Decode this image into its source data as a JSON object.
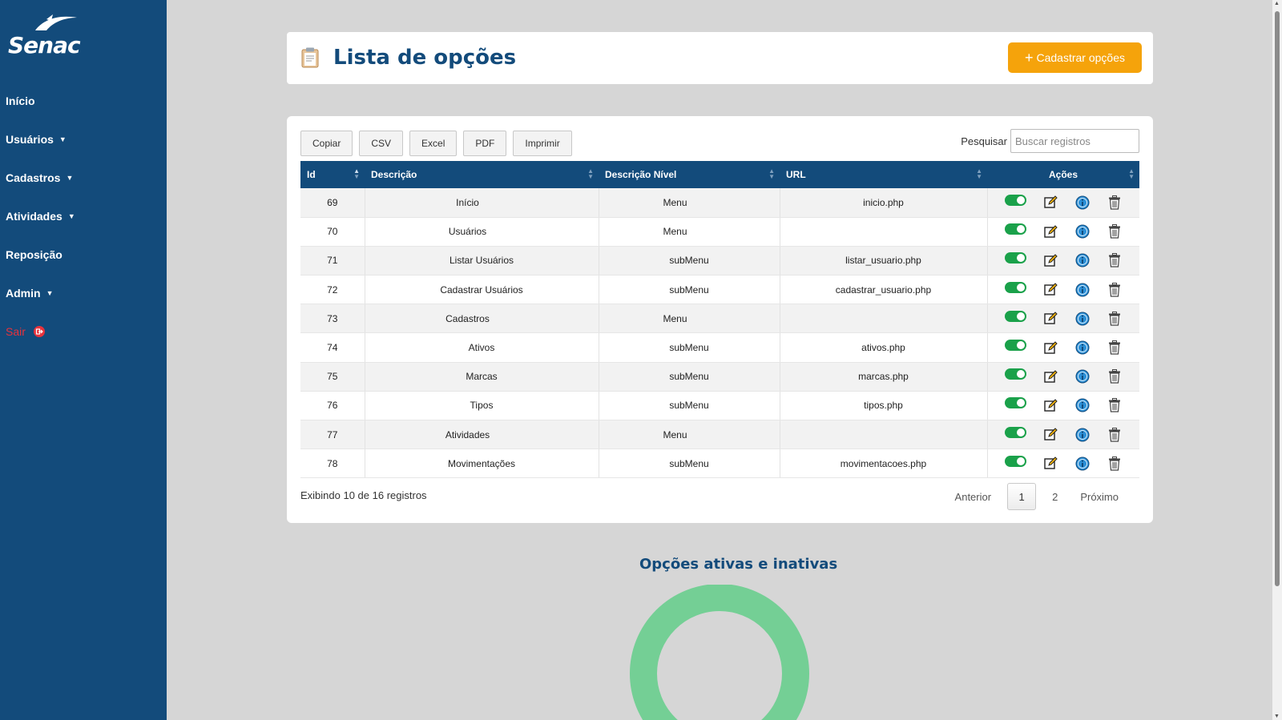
{
  "brand": {
    "logo_text": "Senac",
    "sidebar_color": "#134b7b"
  },
  "sidebar": {
    "items": [
      {
        "label": "Início",
        "has_caret": false
      },
      {
        "label": "Usuários",
        "has_caret": true
      },
      {
        "label": "Cadastros",
        "has_caret": true
      },
      {
        "label": "Atividades",
        "has_caret": true
      },
      {
        "label": "Reposição",
        "has_caret": false
      },
      {
        "label": "Admin",
        "has_caret": true
      }
    ],
    "logout_label": "Sair"
  },
  "header": {
    "title": "Lista de opções",
    "add_button_label": "Cadastrar opções",
    "add_button_color": "#f5a30b"
  },
  "toolbar": {
    "copy": "Copiar",
    "csv": "CSV",
    "excel": "Excel",
    "pdf": "PDF",
    "print": "Imprimir"
  },
  "search": {
    "label": "Pesquisar",
    "placeholder": "Buscar registros",
    "value": ""
  },
  "table": {
    "columns": [
      "Id",
      "Descrição",
      "Descrição Nível",
      "URL",
      "Ações"
    ],
    "rows": [
      {
        "id": "69",
        "descricao": "Início",
        "nivel": "Menu",
        "url": "inicio.php",
        "active": true
      },
      {
        "id": "70",
        "descricao": "Usuários",
        "nivel": "Menu",
        "url": "",
        "active": true
      },
      {
        "id": "71",
        "descricao": "Listar Usuários",
        "nivel": "subMenu",
        "url": "listar_usuario.php",
        "active": true
      },
      {
        "id": "72",
        "descricao": "Cadastrar Usuários",
        "nivel": "subMenu",
        "url": "cadastrar_usuario.php",
        "active": true
      },
      {
        "id": "73",
        "descricao": "Cadastros",
        "nivel": "Menu",
        "url": "",
        "active": true
      },
      {
        "id": "74",
        "descricao": "Ativos",
        "nivel": "subMenu",
        "url": "ativos.php",
        "active": true
      },
      {
        "id": "75",
        "descricao": "Marcas",
        "nivel": "subMenu",
        "url": "marcas.php",
        "active": true
      },
      {
        "id": "76",
        "descricao": "Tipos",
        "nivel": "subMenu",
        "url": "tipos.php",
        "active": true
      },
      {
        "id": "77",
        "descricao": "Atividades",
        "nivel": "Menu",
        "url": "",
        "active": true
      },
      {
        "id": "78",
        "descricao": "Movimentações",
        "nivel": "subMenu",
        "url": "movimentacoes.php",
        "active": true
      }
    ],
    "icons": {
      "toggle": "toggle-icon",
      "edit": "edit-icon",
      "info": "info-icon",
      "delete": "trash-icon"
    }
  },
  "footer": {
    "info": "Exibindo 10 de 16 registros",
    "prev": "Anterior",
    "pages": [
      "1",
      "2"
    ],
    "current_page": "1",
    "next": "Próximo"
  },
  "chart": {
    "title": "Opções ativas e inativas",
    "ring_color": "#74cf95"
  }
}
